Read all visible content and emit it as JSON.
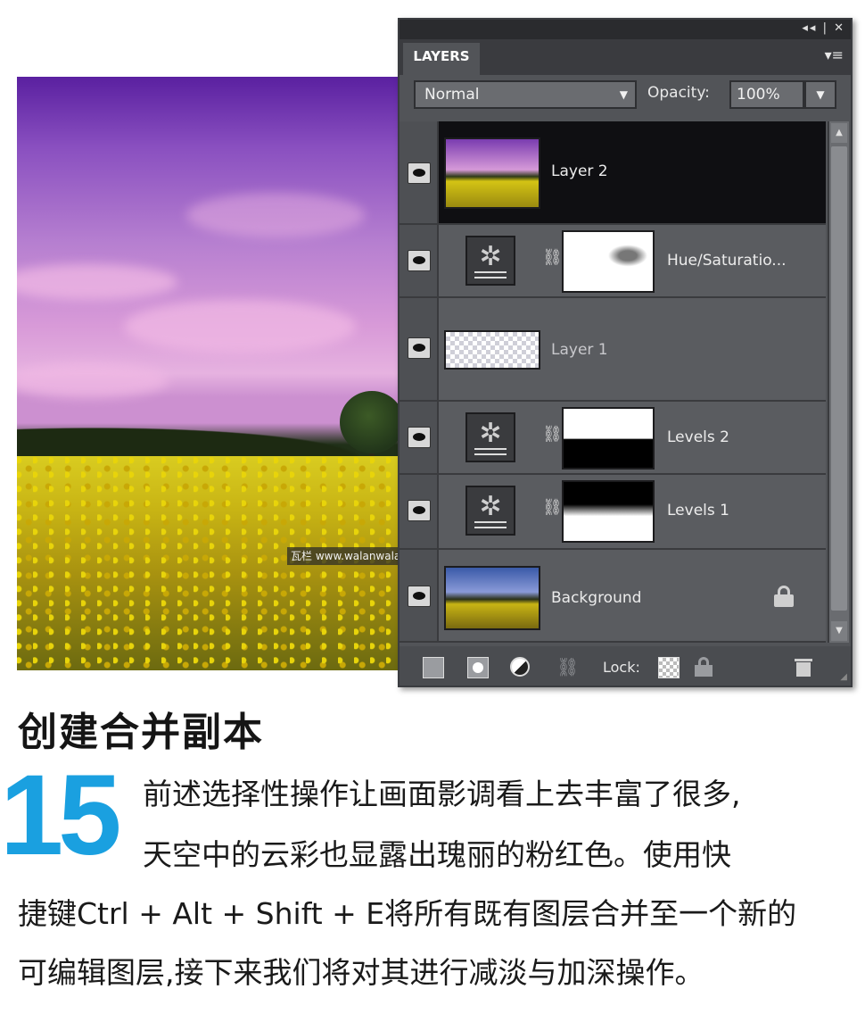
{
  "photo": {
    "watermark": "瓦栏 www.walanwalan.com"
  },
  "panel": {
    "title_controls": "◂◂ | ✕",
    "tab_label": "LAYERS",
    "menu_glyph": "▾≡",
    "blend_mode": "Normal",
    "opacity_label": "Opacity:",
    "opacity_value": "100%",
    "layers": [
      {
        "name": "Layer 2",
        "selected": true
      },
      {
        "name": "Hue/Saturatio...",
        "type": "adjustment"
      },
      {
        "name": "Layer 1"
      },
      {
        "name": "Levels 2",
        "type": "adjustment"
      },
      {
        "name": "Levels 1",
        "type": "adjustment"
      },
      {
        "name": "Background",
        "locked": true
      }
    ],
    "lock_label": "Lock:"
  },
  "article": {
    "heading": "创建合并副本",
    "step_number": "15",
    "lines": [
      "前述选择性操作让画面影调看上去丰富了很多,",
      "天空中的云彩也显露出瑰丽的粉红色。使用快",
      "捷键Ctrl + Alt + Shift + E将所有既有图层合并至一个新的",
      "可编辑图层,接下来我们将对其进行减淡与加深操作。"
    ]
  },
  "colors": {
    "step_number": "#1aa0e0",
    "panel_bg": "#525458",
    "selected_row": "#0f0f12"
  }
}
